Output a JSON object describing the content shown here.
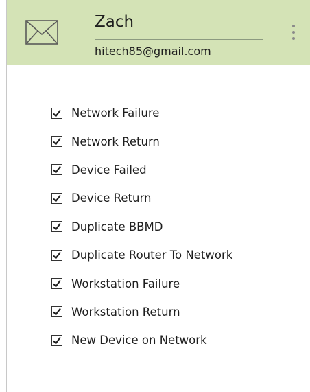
{
  "header": {
    "name": "Zach",
    "email": "hitech85@gmail.com",
    "background_color": "#d4e3b6",
    "icon": "envelope-icon",
    "menu_icon": "more-vertical-icon"
  },
  "notifications": [
    {
      "label": "Network Failure",
      "checked": true
    },
    {
      "label": "Network Return",
      "checked": true
    },
    {
      "label": "Device Failed",
      "checked": true
    },
    {
      "label": "Device Return",
      "checked": true
    },
    {
      "label": "Duplicate BBMD",
      "checked": true
    },
    {
      "label": "Duplicate Router To Network",
      "checked": true
    },
    {
      "label": "Workstation Failure",
      "checked": true
    },
    {
      "label": "Workstation Return",
      "checked": true
    },
    {
      "label": "New Device on Network",
      "checked": true
    }
  ]
}
